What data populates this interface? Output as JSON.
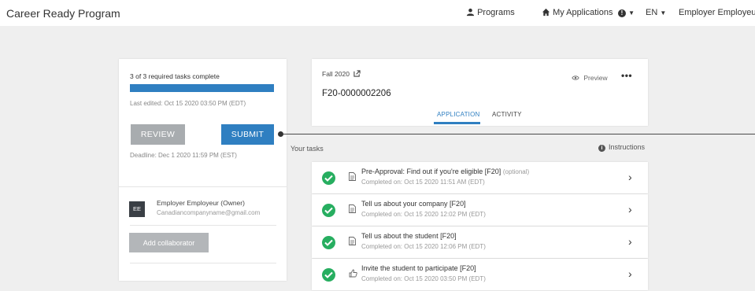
{
  "app": {
    "title": "Career Ready Program"
  },
  "nav": {
    "programs": "Programs",
    "my_applications": "My Applications",
    "language": "EN",
    "user": "Employer Employeur"
  },
  "sidebar": {
    "required_tasks": "3 of 3 required tasks complete",
    "progress": 1.0,
    "last_edited": "Last edited: Oct 15 2020 03:50 PM (EDT)",
    "review_label": "REVIEW",
    "submit_label": "SUBMIT",
    "deadline": "Deadline: Dec 1 2020 11:59 PM (EST)",
    "owner": {
      "initials": "EE",
      "name": "Employer Employeur (Owner)",
      "email": "Canadiancompanyname@gmail.com"
    },
    "add_collaborator_label": "Add collaborator"
  },
  "application": {
    "term": "Fall 2020",
    "id": "F20-0000002206",
    "preview_label": "Preview",
    "more_label": "•••",
    "tabs": [
      {
        "label": "APPLICATION",
        "active": true
      },
      {
        "label": "ACTIVITY",
        "active": false
      }
    ]
  },
  "tasks": {
    "heading": "Your tasks",
    "instructions_label": "Instructions",
    "items": [
      {
        "title": "Pre-Approval: Find out if you're eligible [F20]",
        "optional": "(optional)",
        "completed": "Completed on: Oct 15 2020 11:51 AM (EDT)",
        "icon": "document-icon"
      },
      {
        "title": "Tell us about your company [F20]",
        "optional": "",
        "completed": "Completed on: Oct 15 2020 12:02 PM (EDT)",
        "icon": "document-icon"
      },
      {
        "title": "Tell us about the student [F20]",
        "optional": "",
        "completed": "Completed on: Oct 15 2020 12:06 PM (EDT)",
        "icon": "document-icon"
      },
      {
        "title": "Invite the student to participate [F20]",
        "optional": "",
        "completed": "Completed on: Oct 15 2020 03:50 PM (EDT)",
        "icon": "thumbs-up-icon"
      }
    ]
  },
  "colors": {
    "accent": "#2f7fc1",
    "success": "#27ae60",
    "background": "#efefef"
  }
}
